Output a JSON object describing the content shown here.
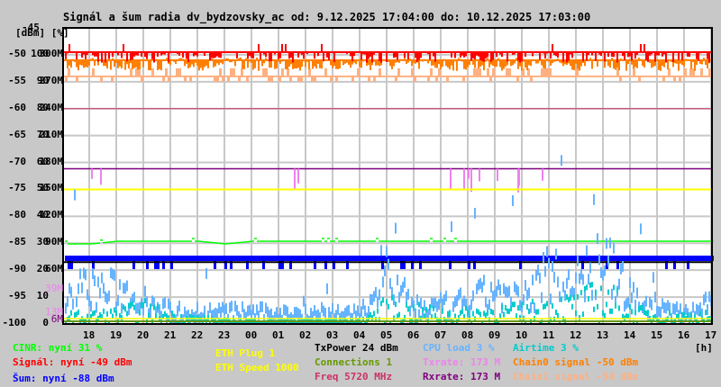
{
  "chart_data": {
    "type": "line",
    "title": "Signál a šum radia dv_bydzovsky_ac od: 9.12.2025 17:04:00 do: 10.12.2025 17:03:00",
    "y_unit_label": "[dBm] [%]",
    "ylim_dbm": [
      -100,
      -45
    ],
    "ylim_percent": [
      0,
      110
    ],
    "ylim_rate": [
      0,
      330
    ],
    "y_ticks": [
      {
        "dbm": "-45",
        "pct": "",
        "rate": ""
      },
      {
        "dbm": "-50",
        "pct": "100",
        "rate": "300M"
      },
      {
        "dbm": "-55",
        "pct": "90",
        "rate": "270M"
      },
      {
        "dbm": "-60",
        "pct": "80",
        "rate": "240M"
      },
      {
        "dbm": "-65",
        "pct": "70",
        "rate": "210M"
      },
      {
        "dbm": "-70",
        "pct": "60",
        "rate": "180M"
      },
      {
        "dbm": "-75",
        "pct": "50",
        "rate": "150M"
      },
      {
        "dbm": "-80",
        "pct": "40",
        "rate": "120M"
      },
      {
        "dbm": "-85",
        "pct": "30",
        "rate": "90M"
      },
      {
        "dbm": "-90",
        "pct": "20",
        "rate": "60M"
      },
      {
        "dbm": "-95",
        "pct": "10",
        "rate": ""
      },
      {
        "dbm": "-100",
        "pct": "0",
        "rate": ""
      }
    ],
    "extra_rate_labels": [
      {
        "text": "39M",
        "color": "#ee82ee"
      },
      {
        "text": "13M",
        "color": "#ee82ee"
      },
      {
        "text": "6M",
        "color": "#800080"
      }
    ],
    "x_ticks": [
      "18",
      "19",
      "20",
      "21",
      "22",
      "23",
      "00",
      "01",
      "02",
      "03",
      "04",
      "05",
      "06",
      "07",
      "08",
      "09",
      "10",
      "11",
      "12",
      "13",
      "14",
      "15",
      "16",
      "17"
    ],
    "x_unit": "[h]",
    "grid": true,
    "series": [
      {
        "name": "Signál",
        "color": "#ff0000",
        "unit": "dBm",
        "level": -49,
        "values_hourly": [
          -49.5,
          -49.5,
          -49.5,
          -49.5,
          -49.5,
          -49.5,
          -49.5,
          -49.5,
          -49.5,
          -49.5,
          -49.5,
          -49.5,
          -49.5,
          -49.5,
          -49.5,
          -49.5,
          -49.5,
          -49.5,
          -49.5,
          -49.5,
          -49.5,
          -49.5,
          -49.5,
          -49
        ]
      },
      {
        "name": "Chain0 signal",
        "color": "#ff8000",
        "unit": "dBm",
        "level": -50,
        "values_hourly": [
          -51,
          -51,
          -51,
          -51,
          -51,
          -51,
          -51,
          -51,
          -51,
          -51,
          -51,
          -51,
          -51,
          -51,
          -51,
          -51,
          -51,
          -51,
          -51,
          -51,
          -51,
          -51,
          -51,
          -50
        ]
      },
      {
        "name": "Chain1 signal",
        "color": "#ffb080",
        "unit": "dBm",
        "level": -54,
        "values_hourly": [
          -54,
          -54,
          -54,
          -54,
          -54,
          -54,
          -54,
          -54,
          -54,
          -54,
          -54,
          -54,
          -54,
          -54,
          -54,
          -54,
          -54,
          -54,
          -54,
          -54,
          -54,
          -54,
          -54,
          -54
        ]
      },
      {
        "name": "Freq",
        "color": "#cc3366",
        "unit": "MHz",
        "level_dbm_axis": -60
      },
      {
        "name": "Rxrate",
        "color": "#800080",
        "unit": "M",
        "level": 173
      },
      {
        "name": "Txrate",
        "color": "#ee82ee",
        "unit": "M",
        "level": 173
      },
      {
        "name": "ETH Speed",
        "color": "#ffff00",
        "level_dbm_axis": -75
      },
      {
        "name": "CINR",
        "color": "#00ff00",
        "unit": "%",
        "level": 31,
        "values_hourly": [
          30,
          31,
          31,
          31,
          31,
          30,
          31,
          31,
          31,
          31,
          31,
          31,
          31,
          31,
          31,
          31,
          31,
          31,
          31,
          31,
          31,
          31,
          31,
          31
        ]
      },
      {
        "name": "Šum",
        "color": "#0000ff",
        "unit": "dBm",
        "level": -88,
        "values_hourly": [
          -88,
          -88,
          -88,
          -88,
          -88,
          -88,
          -88,
          -88,
          -88,
          -88,
          -88,
          -88,
          -88,
          -88,
          -88,
          -88,
          -88,
          -88,
          -88,
          -88,
          -88,
          -88,
          -88,
          -88
        ]
      },
      {
        "name": "TxPower",
        "color": "#000000",
        "unit": "dBm",
        "level_dbm_axis": -88.5
      },
      {
        "name": "CPU load",
        "color": "#66b3ff",
        "unit": "%",
        "level": 3,
        "values_hourly": [
          15,
          14,
          11,
          6,
          6,
          6,
          6,
          5,
          6,
          6,
          5,
          18,
          8,
          8,
          10,
          14,
          10,
          22,
          18,
          25,
          12,
          8,
          6,
          9
        ]
      },
      {
        "name": "Airtime",
        "color": "#00cccc",
        "unit": "%",
        "level": 3,
        "values_hourly": [
          3,
          4,
          6,
          3,
          2,
          1,
          1,
          1,
          1,
          1,
          1,
          7,
          5,
          4,
          4,
          5,
          5,
          7,
          8,
          12,
          5,
          3,
          3,
          3
        ]
      },
      {
        "name": "ETH Plug",
        "color": "#ffff00",
        "level_pct_axis": 2
      },
      {
        "name": "Connections",
        "color": "#669900",
        "level_pct_axis": 1
      }
    ]
  },
  "legend": {
    "cinr": {
      "label": "CINR: nyní",
      "value": "31 %",
      "color": "#00ff00"
    },
    "signal": {
      "label": "Signál: nyní",
      "value": "-49 dBm",
      "color": "#ff0000"
    },
    "noise": {
      "label": "Šum: nyní",
      "value": "-88 dBm",
      "color": "#0000ff"
    },
    "eth_plug": {
      "text": "ETH Plug 1",
      "color": "#ffff00"
    },
    "eth_speed": {
      "text": "ETH Speed 1000",
      "color": "#ffff00"
    },
    "txpower": {
      "label": "TxPower",
      "value": "24 dBm",
      "color": "#000000"
    },
    "connections": {
      "label": "Connections",
      "value": "1",
      "color": "#669900"
    },
    "freq": {
      "label": "Freq",
      "value": "5720 MHz",
      "color": "#cc3366"
    },
    "cpu": {
      "label": "CPU load",
      "value": "3 %",
      "color": "#66b3ff"
    },
    "txrate": {
      "label": "Txrate:",
      "value": "173 M",
      "color": "#ee82ee"
    },
    "rxrate": {
      "label": "Rxrate:",
      "value": "173 M",
      "color": "#800080"
    },
    "airtime": {
      "label": "Airtime",
      "value": "3 %",
      "color": "#00cccc"
    },
    "chain0": {
      "label": "Chain0 signal",
      "value": "-50 dBm",
      "color": "#ff8000"
    },
    "chain1": {
      "label": "Chain1 signal",
      "value": "-54 dBm",
      "color": "#ffb080"
    }
  }
}
